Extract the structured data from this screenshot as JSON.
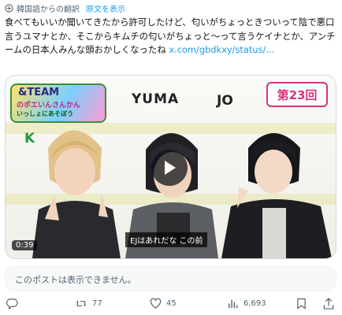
{
  "translation": {
    "notice": "韓国語からの翻訳",
    "original_link": "原文を表示"
  },
  "tweet": {
    "text": "食べてもいいか聞いてきたから許可したけど、匂いがちょっときついって陰で悪口言うユマナとか、そこからキムチの匂いがちょっと〜って言うケイナとか、アンチームの日本人みんな頭おかしくなったね ",
    "link": "x.com/gbdkxy/status/..."
  },
  "video": {
    "logo_line1": "&TEAM",
    "logo_line2": "のポエいんさんかん",
    "logo_line3": "いっしょにあそぼう",
    "name_k": "K",
    "name_yuma": "YUMA",
    "name_jo": "JO",
    "episode": "第23回",
    "duration": "0:39",
    "subtitle": "EJはあれだな この前"
  },
  "quoted_unavailable": "このポストは表示できません。",
  "actions": {
    "retweets": "77",
    "likes": "45",
    "views": "6,693"
  },
  "colors": {
    "link": "#1d9bf0",
    "muted": "#536471",
    "episode_accent": "#d8327a"
  }
}
